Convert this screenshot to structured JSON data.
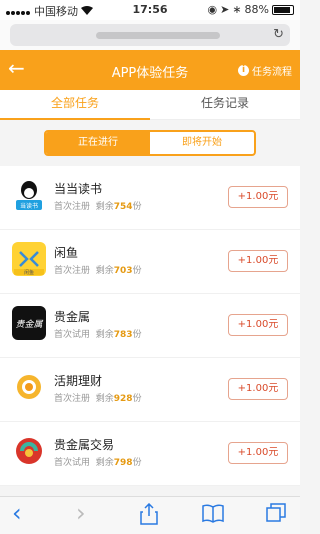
{
  "status_bar": {
    "carrier": "中国移动",
    "time": "17:56",
    "battery": "88%",
    "battery_level": 0.88
  },
  "browser": {
    "reload_icon": "reload-icon"
  },
  "header": {
    "title": "APP体验任务",
    "rules_label": "任务流程",
    "info_glyph": "i",
    "background_color": "#f9a11b"
  },
  "tabs": [
    {
      "label": "全部任务",
      "active": true
    },
    {
      "label": "任务记录",
      "active": false
    }
  ],
  "segment": [
    {
      "label": "正在进行",
      "active": true
    },
    {
      "label": "即将开始",
      "active": false
    }
  ],
  "tasks": [
    {
      "name": "当当读书",
      "type": "首次注册",
      "remaining_label": "剩余",
      "remaining": "754",
      "unit": "份",
      "reward": "+1.00元",
      "icon": "dangdang-reading-icon",
      "icon_text": "当读书"
    },
    {
      "name": "闲鱼",
      "type": "首次注册",
      "remaining_label": "剩余",
      "remaining": "703",
      "unit": "份",
      "reward": "+1.00元",
      "icon": "xianyu-icon",
      "icon_text": "闲鱼"
    },
    {
      "name": "贵金属",
      "type": "首次试用",
      "remaining_label": "剩余",
      "remaining": "783",
      "unit": "份",
      "reward": "+1.00元",
      "icon": "precious-metal-icon",
      "icon_text": "贵金属"
    },
    {
      "name": "活期理财",
      "type": "首次注册",
      "remaining_label": "剩余",
      "remaining": "928",
      "unit": "份",
      "reward": "+1.00元",
      "icon": "current-finance-icon"
    },
    {
      "name": "贵金属交易",
      "type": "首次试用",
      "remaining_label": "剩余",
      "remaining": "798",
      "unit": "份",
      "reward": "+1.00元",
      "icon": "metal-trading-icon"
    }
  ],
  "toolbar": {
    "back": "‹",
    "forward": "›",
    "share": "⇪",
    "bookmarks": "📖",
    "tabs": "⧉"
  }
}
